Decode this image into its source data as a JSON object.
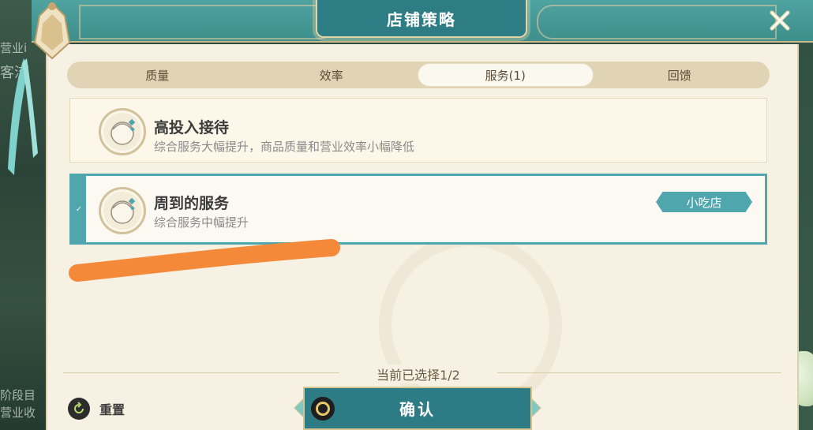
{
  "background": {
    "left_texts": [
      "营业i",
      "客流",
      "阶段目",
      "营业收"
    ]
  },
  "header": {
    "title": "店铺策略",
    "close_icon": "close-x-icon"
  },
  "tabs": [
    {
      "label": "质量",
      "active": false
    },
    {
      "label": "效率",
      "active": false
    },
    {
      "label": "服务(1)",
      "active": true
    },
    {
      "label": "回馈",
      "active": false
    }
  ],
  "strategies": [
    {
      "title": "高投入接待",
      "description": "综合服务大幅提升，商品质量和营业效率小幅降低",
      "selected": false
    },
    {
      "title": "周到的服务",
      "description": "综合服务中幅提升",
      "selected": true,
      "tag": "小吃店"
    }
  ],
  "footer": {
    "selection_count": "当前已选择1/2",
    "reset_label": "重置",
    "confirm_label": "确认"
  },
  "colors": {
    "accent_teal": "#4fa7ad",
    "header_teal": "#3e8f8c",
    "panel_bg": "#f6f1e3",
    "scribble_orange": "#f5893a"
  }
}
